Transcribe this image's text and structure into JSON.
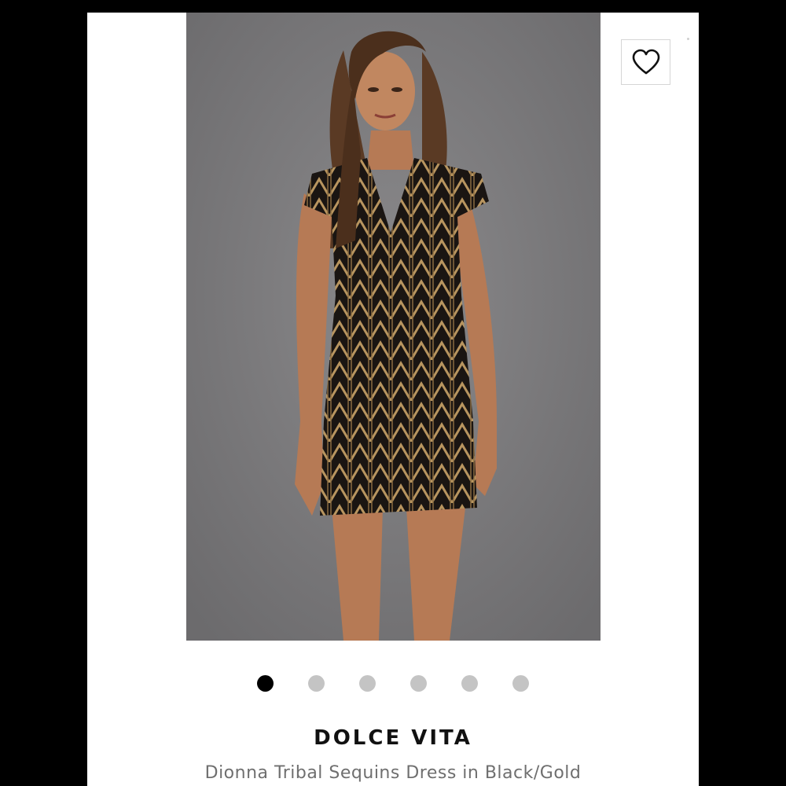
{
  "product": {
    "brand": "DOLCE VITA",
    "name": "Dionna Tribal Sequins Dress in Black/Gold"
  },
  "carousel": {
    "total_images": 6,
    "active_index": 0
  },
  "icons": {
    "favorite": "heart-outline-icon"
  },
  "colors": {
    "page_background": "#000000",
    "card_background": "#ffffff",
    "photo_background": "#7c7b7d",
    "active_dot": "#000000",
    "inactive_dot": "#c4c4c4",
    "brand_text": "#111111",
    "product_text": "#6f6f6f"
  }
}
